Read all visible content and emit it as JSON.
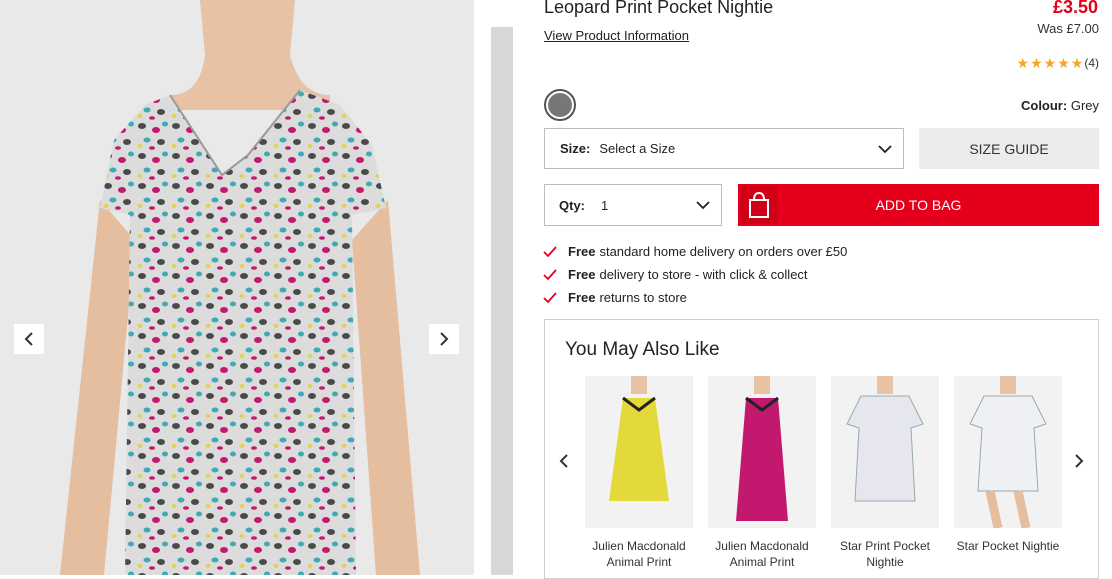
{
  "product": {
    "title": "Leopard Print Pocket Nightie",
    "view_info_link": "View Product Information",
    "price": "£3.50",
    "was_price": "Was £7.00",
    "rating": 5,
    "review_count": "(4)",
    "colour_label": "Colour:",
    "colour_value": "Grey",
    "swatch_color": "#777777"
  },
  "gallery": {
    "prev_icon": "chevron-left-icon",
    "next_icon": "chevron-right-icon"
  },
  "size": {
    "label": "Size:",
    "value": "Select a Size",
    "guide_label": "SIZE GUIDE"
  },
  "qty": {
    "label": "Qty:",
    "value": "1"
  },
  "add_to_bag": {
    "label": "ADD TO BAG",
    "color": "#e4001b"
  },
  "benefits": [
    {
      "bold": "Free",
      "text": "standard home delivery on orders over £50"
    },
    {
      "bold": "Free",
      "text": "delivery to store - with click & collect"
    },
    {
      "bold": "Free",
      "text": "returns to store"
    }
  ],
  "recommendations": {
    "title": "You May Also Like",
    "items": [
      {
        "name": "Julien Macdonald Animal Print",
        "color": "#e3d93a"
      },
      {
        "name": "Julien Macdonald Animal Print",
        "color": "#c2186e"
      },
      {
        "name": "Star Print Pocket Nightie",
        "color": "#ededf2"
      },
      {
        "name": "Star Pocket Nightie",
        "color": "#eef0f3"
      }
    ]
  }
}
